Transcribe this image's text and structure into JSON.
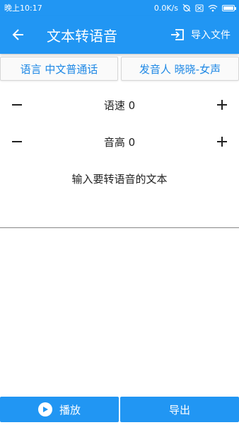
{
  "status_bar": {
    "time": "晚上10:17",
    "network_speed": "0.0K/s",
    "battery_level": 0.85
  },
  "app_bar": {
    "title": "文本转语音",
    "import_label": "导入文件",
    "back_icon": "arrow-left-icon",
    "import_icon": "import-file-icon"
  },
  "selectors": {
    "language_label": "语言 中文普通话",
    "voice_label": "发音人 晓晓-女声"
  },
  "speed": {
    "label": "语速 0"
  },
  "pitch": {
    "label": "音高 0"
  },
  "input": {
    "placeholder": "输入要转语音的文本"
  },
  "bottom": {
    "play_label": "播放",
    "export_label": "导出"
  },
  "colors": {
    "primary": "#2196f3",
    "accent_text": "#1e88e5"
  }
}
